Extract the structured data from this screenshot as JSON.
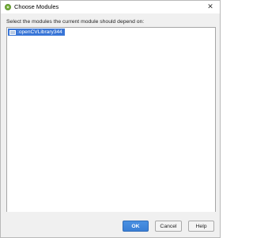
{
  "window": {
    "title": "Choose Modules",
    "close_glyph": "✕"
  },
  "main": {
    "prompt": "Select the modules the current module should depend on:",
    "modules": [
      {
        "label": ":openCVLibrary344",
        "icon": "module-folder-icon",
        "selected": true
      }
    ]
  },
  "footer": {
    "ok_label": "OK",
    "cancel_label": "Cancel",
    "help_label": "Help"
  },
  "colors": {
    "selection": "#3875d7",
    "primary_button": "#3a7fd5",
    "dialog_background": "#f0f0f0"
  }
}
